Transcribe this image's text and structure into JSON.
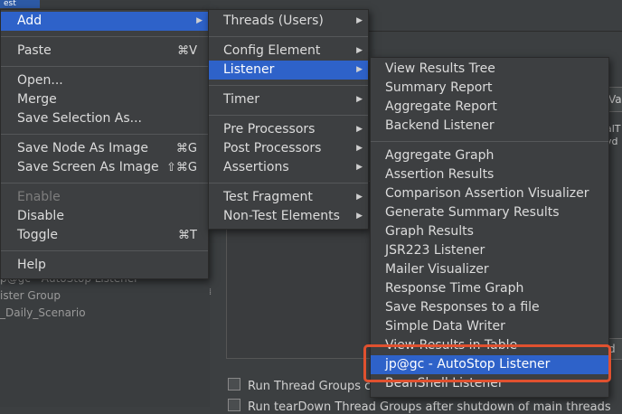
{
  "background": {
    "top_strip": "est",
    "tree_items": [
      "p@gc - AutoStop Listener",
      "ister Group",
      "_Daily_Scenario"
    ],
    "right_field1": "Va",
    "right_text1_lines": [
      "alT",
      "vd"
    ],
    "right_field2": "d",
    "checkbox_run_thread_groups": "Run Thread Groups cc",
    "checkbox_row2": "Run tearDown Thread Groups after shutdown of main threads"
  },
  "main_menu": {
    "items": [
      {
        "label": "Add",
        "shortcut": "",
        "selected": true,
        "submenu": true
      },
      {
        "label": "Paste",
        "shortcut": "⌘V"
      },
      {
        "label": "Open..."
      },
      {
        "label": "Merge"
      },
      {
        "label": "Save Selection As..."
      },
      {
        "label": "Save Node As Image",
        "shortcut": "⌘G"
      },
      {
        "label": "Save Screen As Image",
        "shortcut": "⇧⌘G"
      },
      {
        "label": "Enable",
        "disabled": true
      },
      {
        "label": "Disable"
      },
      {
        "label": "Toggle",
        "shortcut": "⌘T"
      },
      {
        "label": "Help"
      }
    ]
  },
  "add_menu": {
    "items": [
      {
        "label": "Threads (Users)"
      },
      {
        "label": "Config Element"
      },
      {
        "label": "Listener",
        "selected": true
      },
      {
        "label": "Timer"
      },
      {
        "label": "Pre Processors"
      },
      {
        "label": "Post Processors"
      },
      {
        "label": "Assertions"
      },
      {
        "label": "Test Fragment"
      },
      {
        "label": "Non-Test Elements"
      }
    ]
  },
  "listener_menu": {
    "items": [
      "View Results Tree",
      "Summary Report",
      "Aggregate Report",
      "Backend Listener",
      "Aggregate Graph",
      "Assertion Results",
      "Comparison Assertion Visualizer",
      "Generate Summary Results",
      "Graph Results",
      "JSR223 Listener",
      "Mailer Visualizer",
      "Response Time Graph",
      "Save Responses to a file",
      "Simple Data Writer",
      "View Results in Table",
      "jp@gc - AutoStop Listener",
      "BeanShell Listener"
    ],
    "selected": "jp@gc - AutoStop Listener"
  },
  "colors": {
    "selection": "#2e62c9",
    "highlight_outline": "#e0512f"
  }
}
